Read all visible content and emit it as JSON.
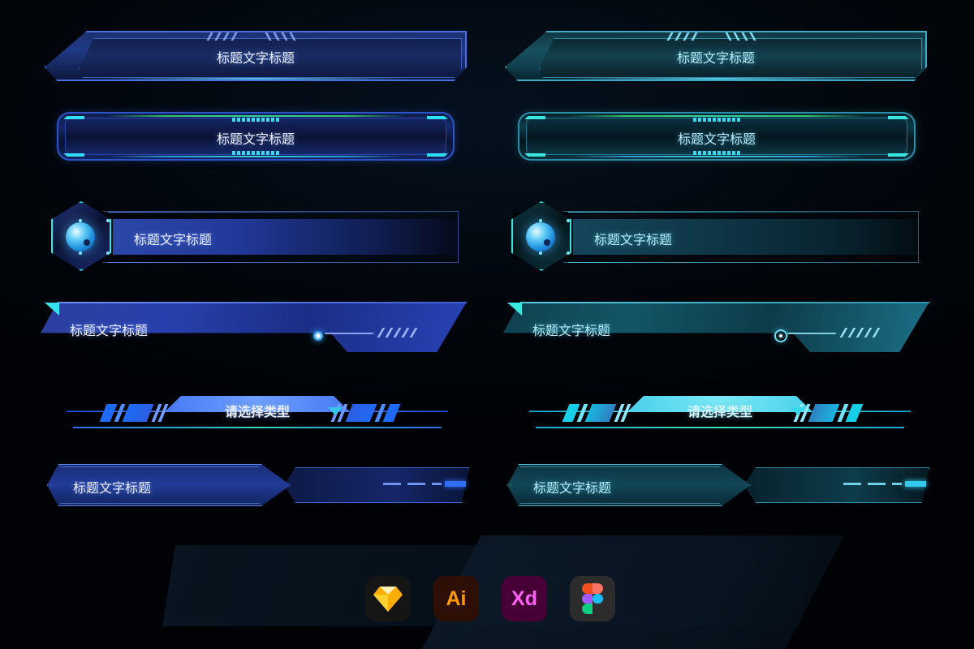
{
  "meta": {
    "title_text": "标题文字标题",
    "select_text": "请选择类型",
    "accent_blue": "#2846a8",
    "accent_cyan": "#2b8ea6",
    "glow_cyan": "#35d8e8",
    "background": "#000205"
  },
  "rows": [
    {
      "id": "angled-trapezoid-banner",
      "blue_label": "标题文字标题",
      "cyan_label": "标题文字标题"
    },
    {
      "id": "rounded-capsule-bar",
      "blue_label": "标题文字标题",
      "cyan_label": "标题文字标题"
    },
    {
      "id": "hexagon-badge-bar",
      "blue_label": "标题文字标题",
      "cyan_label": "标题文字标题"
    },
    {
      "id": "slanted-parallelogram-bar",
      "blue_label": "标题文字标题",
      "cyan_label": "标题文字标题"
    },
    {
      "id": "dropdown-select",
      "blue_label": "请选择类型",
      "cyan_label": "请选择类型"
    },
    {
      "id": "arrow-label-bar",
      "blue_label": "标题文字标题",
      "cyan_label": "标题文字标题"
    }
  ],
  "logos": [
    {
      "name": "sketch",
      "label": ""
    },
    {
      "name": "illustrator",
      "label": "Ai"
    },
    {
      "name": "adobe-xd",
      "label": "Xd"
    },
    {
      "name": "figma",
      "label": ""
    }
  ]
}
